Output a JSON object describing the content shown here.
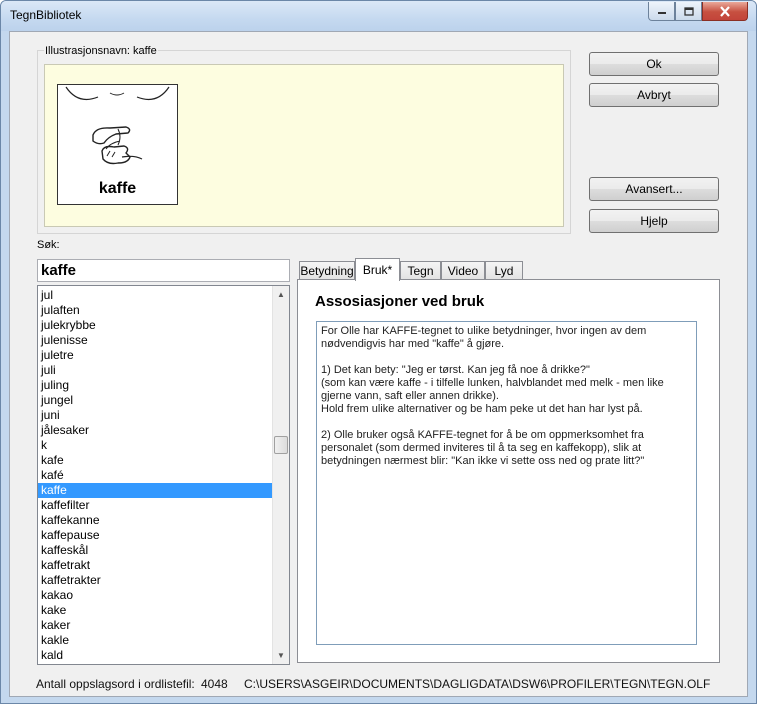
{
  "window": {
    "title": "TegnBibliotek"
  },
  "illustration": {
    "name_label": "Illustrasjonsnavn: kaffe",
    "card_word": "kaffe"
  },
  "buttons": {
    "ok": "Ok",
    "cancel": "Avbryt",
    "advanced": "Avansert...",
    "help": "Hjelp"
  },
  "search": {
    "label": "Søk:",
    "value": "kaffe"
  },
  "list": {
    "items": [
      "jul",
      "julaften",
      "julekrybbe",
      "julenisse",
      "juletre",
      "juli",
      "juling",
      "jungel",
      "juni",
      "jålesaker",
      "k",
      "kafe",
      "kafé",
      "kaffe",
      "kaffefilter",
      "kaffekanne",
      "kaffepause",
      "kaffeskål",
      "kaffetrakt",
      "kaffetrakter",
      "kakao",
      "kake",
      "kaker",
      "kakle",
      "kald"
    ],
    "selected": "kaffe"
  },
  "tabs": [
    {
      "label": "Betydning",
      "active": false
    },
    {
      "label": "Bruk*",
      "active": true
    },
    {
      "label": "Tegn",
      "active": false
    },
    {
      "label": "Video",
      "active": false
    },
    {
      "label": "Lyd",
      "active": false
    }
  ],
  "panel": {
    "heading": "Assosiasjoner ved bruk",
    "paragraphs": [
      "For Olle har KAFFE-tegnet to ulike betydninger, hvor ingen av dem nødvendigvis har med \"kaffe\" å gjøre.",
      "1) Det kan bety: \"Jeg er tørst. Kan jeg få noe å drikke?\"\n(som kan være kaffe - i tilfelle lunken, halvblandet med melk - men like gjerne vann, saft eller annen drikke).\nHold frem ulike alternativer og be ham peke ut det han har lyst på.",
      "2) Olle bruker også KAFFE-tegnet for å be om oppmerksomhet fra personalet (som dermed inviteres til å ta seg en kaffekopp), slik at betydningen nærmest blir: \"Kan ikke vi sette oss ned og prate litt?\""
    ]
  },
  "status": {
    "count_label": "Antall oppslagsord i ordlistefil:",
    "count": "4048",
    "path": "C:\\USERS\\ASGEIR\\DOCUMENTS\\DAGLIGDATA\\DSW6\\PROFILER\\TEGN\\TEGN.OLF"
  }
}
